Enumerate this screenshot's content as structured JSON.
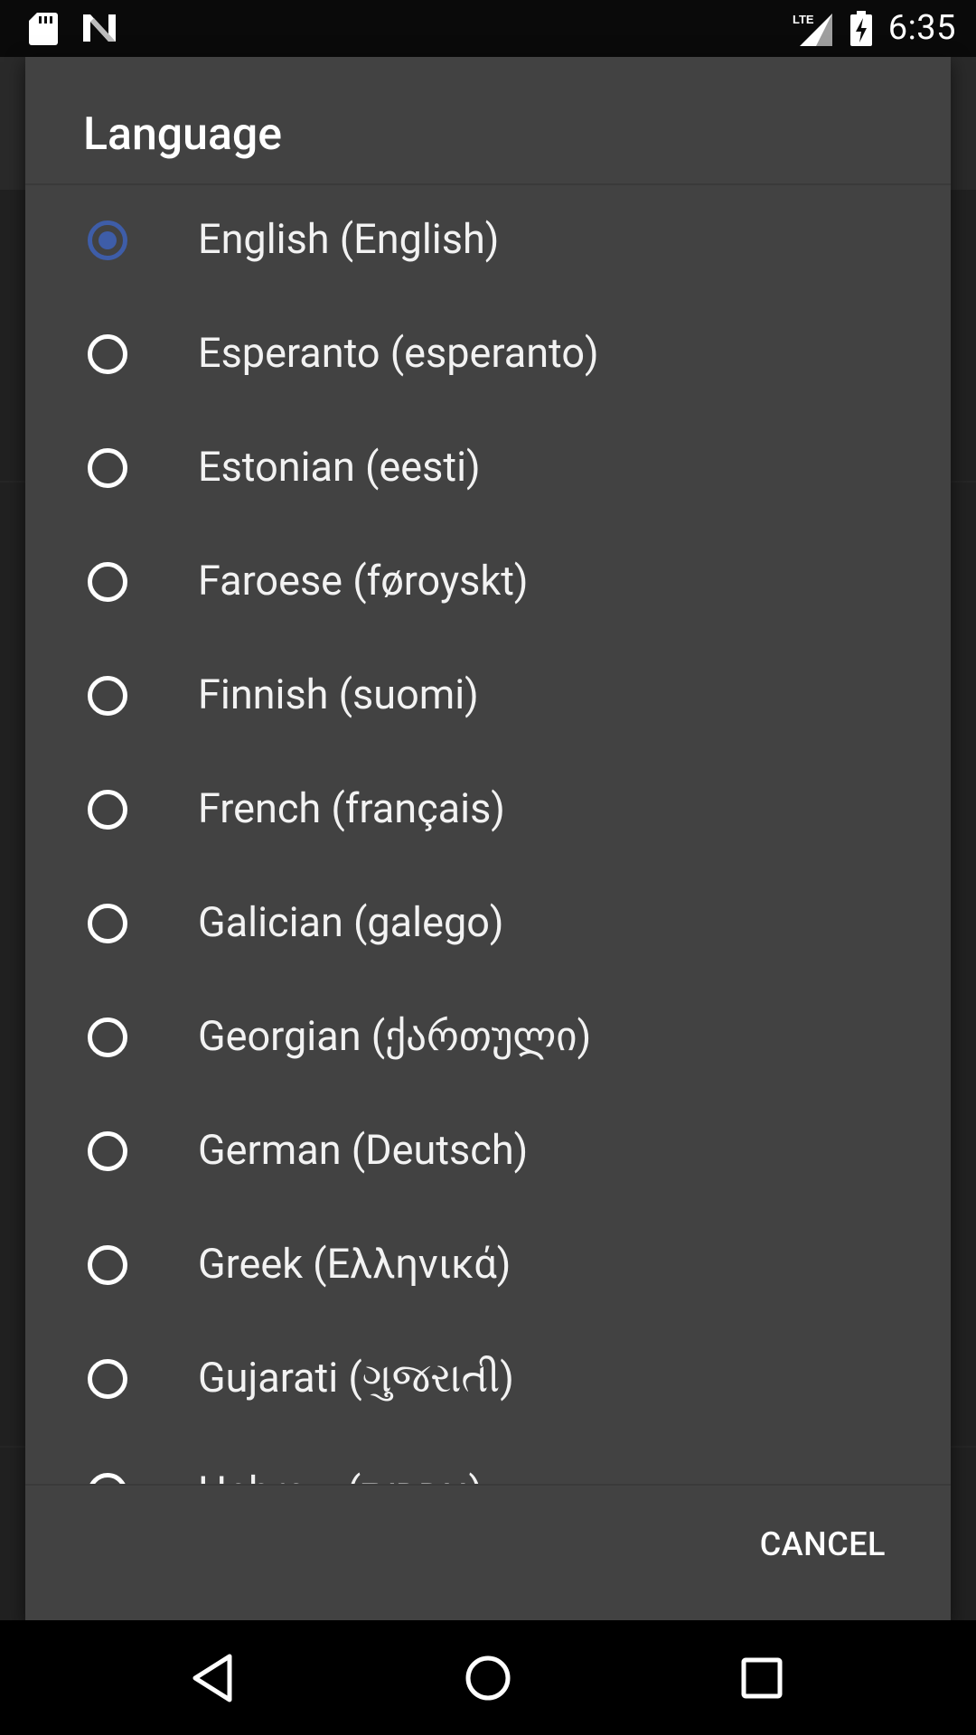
{
  "status_bar": {
    "time": "6:35",
    "network": "LTE",
    "icons": [
      "sd-card-icon",
      "n-icon",
      "signal-icon",
      "battery-charging-icon"
    ]
  },
  "dialog": {
    "title": "Language",
    "options": [
      {
        "label": "English (English)",
        "checked": true
      },
      {
        "label": "Esperanto (esperanto)",
        "checked": false
      },
      {
        "label": "Estonian (eesti)",
        "checked": false
      },
      {
        "label": "Faroese (føroyskt)",
        "checked": false
      },
      {
        "label": "Finnish (suomi)",
        "checked": false
      },
      {
        "label": "French (français)",
        "checked": false
      },
      {
        "label": "Galician (galego)",
        "checked": false
      },
      {
        "label": "Georgian (ქართული)",
        "checked": false
      },
      {
        "label": "German (Deutsch)",
        "checked": false
      },
      {
        "label": "Greek (Ελληνικά)",
        "checked": false
      },
      {
        "label": "Gujarati (ગુજરાતી)",
        "checked": false
      },
      {
        "label": "Hebrew (עברית)",
        "checked": false
      }
    ],
    "cancel_label": "CANCEL"
  },
  "nav_bar": {
    "icons": [
      "back-icon",
      "home-icon",
      "recents-icon"
    ]
  },
  "colors": {
    "dialog_bg": "#424242",
    "accent": "#3e5da8",
    "text": "#f2f2f2"
  }
}
